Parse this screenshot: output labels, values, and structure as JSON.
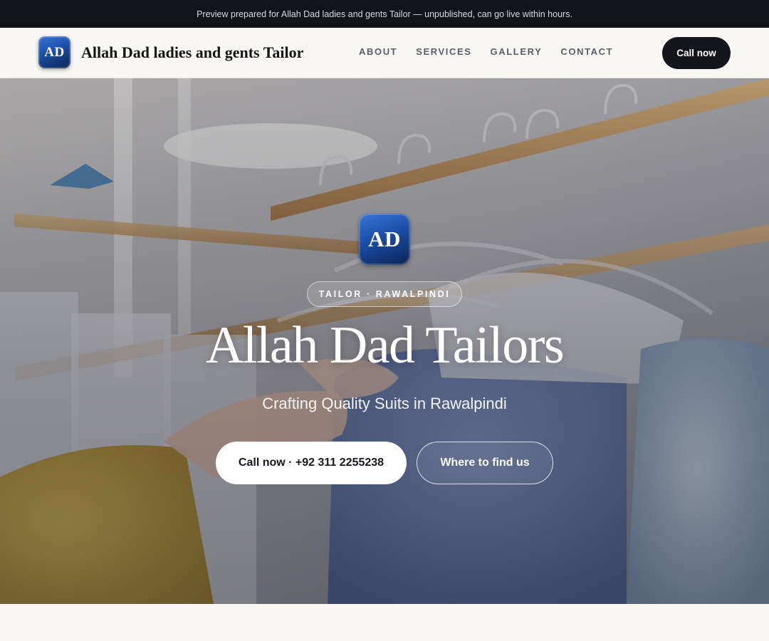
{
  "banner": {
    "text": "Preview prepared for Allah Dad ladies and gents Tailor — unpublished, can go live within hours."
  },
  "header": {
    "logo_initials": "AD",
    "brand_name": "Allah Dad ladies and gents Tailor",
    "nav": [
      {
        "label": "About"
      },
      {
        "label": "Services"
      },
      {
        "label": "Gallery"
      },
      {
        "label": "Contact"
      }
    ],
    "cta_label": "Call now"
  },
  "hero": {
    "logo_initials": "AD",
    "badge": "Tailor · Rawalpindi",
    "title": "Allah Dad Tailors",
    "subtitle": "Crafting Quality Suits in Rawalpindi",
    "primary_button": "Call now · +92 311 2255238",
    "secondary_button": "Where to find us"
  },
  "colors": {
    "banner_bg": "#111418",
    "header_bg": "#f8f7f4",
    "cta_bg": "#14161b",
    "logo_blue": "#1b4ea6"
  }
}
